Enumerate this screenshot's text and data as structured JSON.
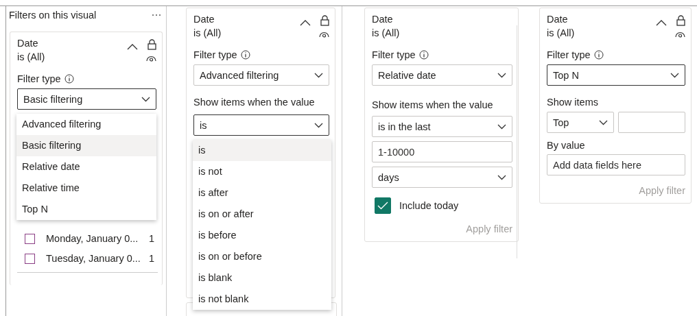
{
  "pane": {
    "title": "Filters on this visual"
  },
  "panels": [
    {
      "kind": "basic",
      "title": "Date",
      "summary": "is (All)",
      "header_icons": true,
      "expanded": true,
      "filter_type": {
        "label": "Filter type",
        "value": "Basic filtering",
        "focused": true,
        "open": true,
        "options": [
          {
            "label": "Advanced filtering",
            "selected": false
          },
          {
            "label": "Basic filtering",
            "selected": true
          },
          {
            "label": "Relative date",
            "selected": false
          },
          {
            "label": "Relative time",
            "selected": false
          },
          {
            "label": "Top N",
            "selected": false
          }
        ]
      },
      "items": [
        {
          "label": "Monday, January 0...",
          "count": "1",
          "checked": false
        },
        {
          "label": "Tuesday, January 0...",
          "count": "1",
          "checked": false
        }
      ]
    },
    {
      "kind": "advanced",
      "title": "Date",
      "summary": "is (All)",
      "header_icons": true,
      "expanded": true,
      "filter_type": {
        "label": "Filter type",
        "value": "Advanced filtering",
        "focused": false
      },
      "condition": {
        "label": "Show items when the value",
        "value": "is",
        "focused": true,
        "open": true,
        "options": [
          {
            "label": "is",
            "selected": true
          },
          {
            "label": "is not",
            "selected": false
          },
          {
            "label": "is after",
            "selected": false
          },
          {
            "label": "is on or after",
            "selected": false
          },
          {
            "label": "is before",
            "selected": false
          },
          {
            "label": "is on or before",
            "selected": false
          },
          {
            "label": "is blank",
            "selected": false
          },
          {
            "label": "is not blank",
            "selected": false
          }
        ]
      }
    },
    {
      "kind": "relative_date",
      "title": "Date",
      "summary": "is (All)",
      "header_icons": false,
      "filter_type": {
        "label": "Filter type",
        "value": "Relative date",
        "focused": false
      },
      "condition_label": "Show items when the value",
      "operator": "is in the last",
      "amount": {
        "placeholder": "1-10000"
      },
      "unit": "days",
      "include_today": {
        "label": "Include today",
        "checked": true
      },
      "apply": {
        "label": "Apply filter",
        "disabled": true
      }
    },
    {
      "kind": "top_n",
      "title": "Date",
      "summary": "is (All)",
      "header_icons": true,
      "expanded": true,
      "filter_type": {
        "label": "Filter type",
        "value": "Top N",
        "focused": true
      },
      "show_items_label": "Show items",
      "direction": "Top",
      "by_value_label": "By value",
      "by_value": {
        "placeholder": "Add data fields here"
      },
      "apply": {
        "label": "Apply filter",
        "disabled": true
      }
    }
  ]
}
